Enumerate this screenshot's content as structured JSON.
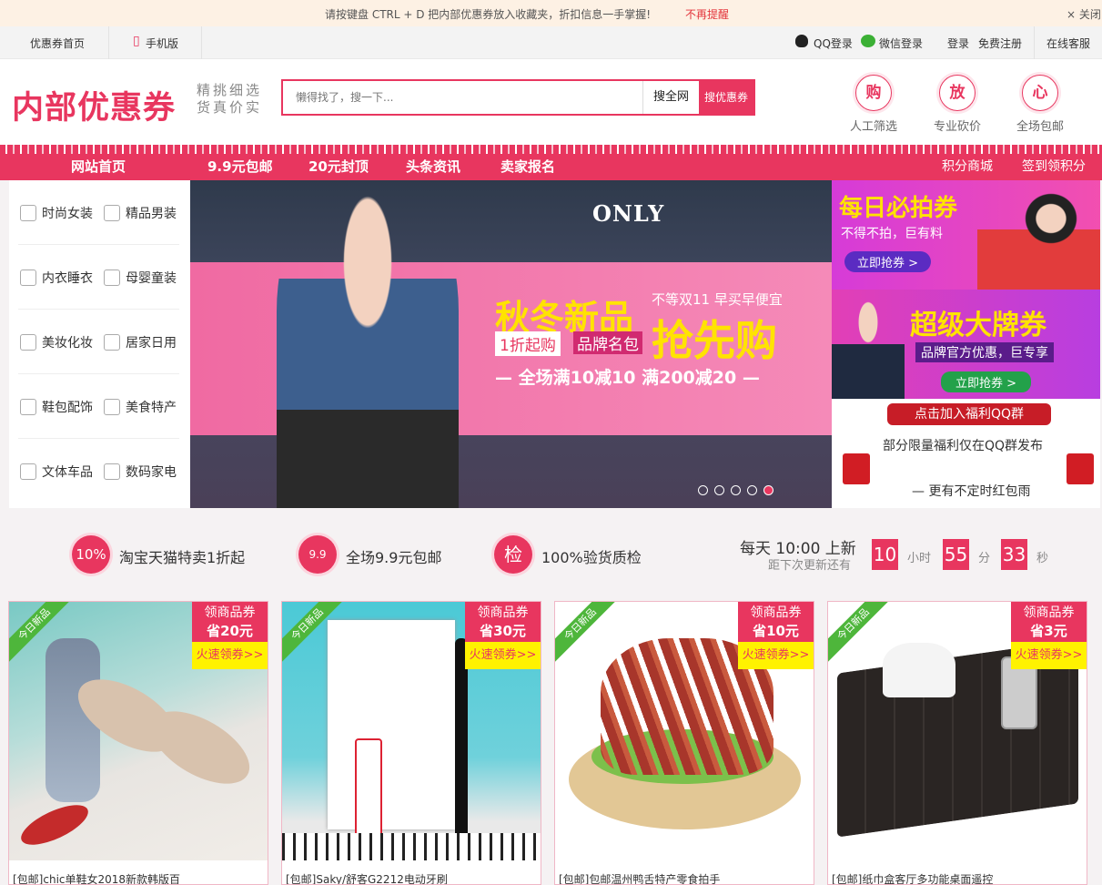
{
  "notice": {
    "message": "请按键盘 CTRL + D 把内部优惠券放入收藏夹，折扣信息一手掌握!",
    "no_remind": "不再提醒",
    "close": "× 关闭"
  },
  "topbar": {
    "home": "优惠券首页",
    "mobile": "手机版",
    "qq_login": "QQ登录",
    "wechat_login": "微信登录",
    "login": "登录",
    "register": "免费注册",
    "service": "在线客服"
  },
  "header": {
    "logo": "内部优惠券",
    "slogan_line1": "精挑细选",
    "slogan_line2": "货真价实",
    "search_placeholder": "懒得找了，搜一下...",
    "search_all": "搜全网",
    "search_coupon": "搜优惠券",
    "features": [
      {
        "icon": "购",
        "label": "人工筛选"
      },
      {
        "icon": "放",
        "label": "专业砍价"
      },
      {
        "icon": "心",
        "label": "全场包邮"
      }
    ]
  },
  "nav": {
    "items": [
      "网站首页",
      "9.9元包邮",
      "20元封顶",
      "头条资讯",
      "卖家报名"
    ],
    "right": [
      "积分商城",
      "签到领积分"
    ]
  },
  "categories": [
    [
      "时尚女装",
      "精品男装"
    ],
    [
      "内衣睡衣",
      "母婴童装"
    ],
    [
      "美妆化妆",
      "居家日用"
    ],
    [
      "鞋包配饰",
      "美食特产"
    ],
    [
      "文体车品",
      "数码家电"
    ]
  ],
  "banner": {
    "brand": "ONLY",
    "title": "秋冬新品",
    "subtitle": "不等双11 早买早便宜",
    "tag1": "1折起购",
    "tag2": "品牌名包",
    "big": "抢先购",
    "deal": "— 全场满10减10 满200减20 —",
    "active_slide": 5,
    "slide_count": 5
  },
  "ads": {
    "ad1": {
      "title": "每日必拍券",
      "sub": "不得不拍，巨有料",
      "button": "立即抢券 >"
    },
    "ad2": {
      "title": "超级大牌券",
      "sub": "品牌官方优惠，巨专享",
      "button": "立即抢券 >"
    },
    "ad3": {
      "title": "点击加入福利QQ群",
      "sub": "部分限量福利仅在QQ群发布",
      "sub2": "— 更有不定时红包雨"
    }
  },
  "promo": {
    "items": [
      {
        "icon": "10%",
        "text": "淘宝天猫特卖1折起"
      },
      {
        "icon": "9.9",
        "text": "全场9.9元包邮"
      },
      {
        "icon": "检",
        "text": "100%验货质检"
      }
    ],
    "timer": {
      "line1": "每天 10:00 上新",
      "line2": "距下次更新还有",
      "hours": "10",
      "hours_unit": "小时",
      "minutes": "55",
      "minutes_unit": "分",
      "seconds": "33",
      "seconds_unit": "秒"
    }
  },
  "products": [
    {
      "ribbon": "今日新品",
      "coupon_label": "领商品券",
      "coupon_value": "省20元",
      "grab": "火速领券>>",
      "title": "[包邮]chic单鞋女2018新款韩版百",
      "image": "shoes"
    },
    {
      "ribbon": "今日新品",
      "coupon_label": "领商品券",
      "coupon_value": "省30元",
      "grab": "火速领券>>",
      "title": "[包邮]Saky/舒客G2212电动牙刷",
      "image": "toothbrush"
    },
    {
      "ribbon": "今日新品",
      "coupon_label": "领商品券",
      "coupon_value": "省10元",
      "grab": "火速领券>>",
      "title": "[包邮]包邮温州鸭舌特产零食拍手",
      "image": "duck-tongue"
    },
    {
      "ribbon": "今日新品",
      "coupon_label": "领商品券",
      "coupon_value": "省3元",
      "grab": "火速领券>>",
      "title": "[包邮]纸巾盒客厅多功能桌面遥控",
      "image": "tissue-box"
    }
  ],
  "colors": {
    "accent": "#e8365f",
    "yellow": "#fff200",
    "green": "#4eb63b"
  }
}
